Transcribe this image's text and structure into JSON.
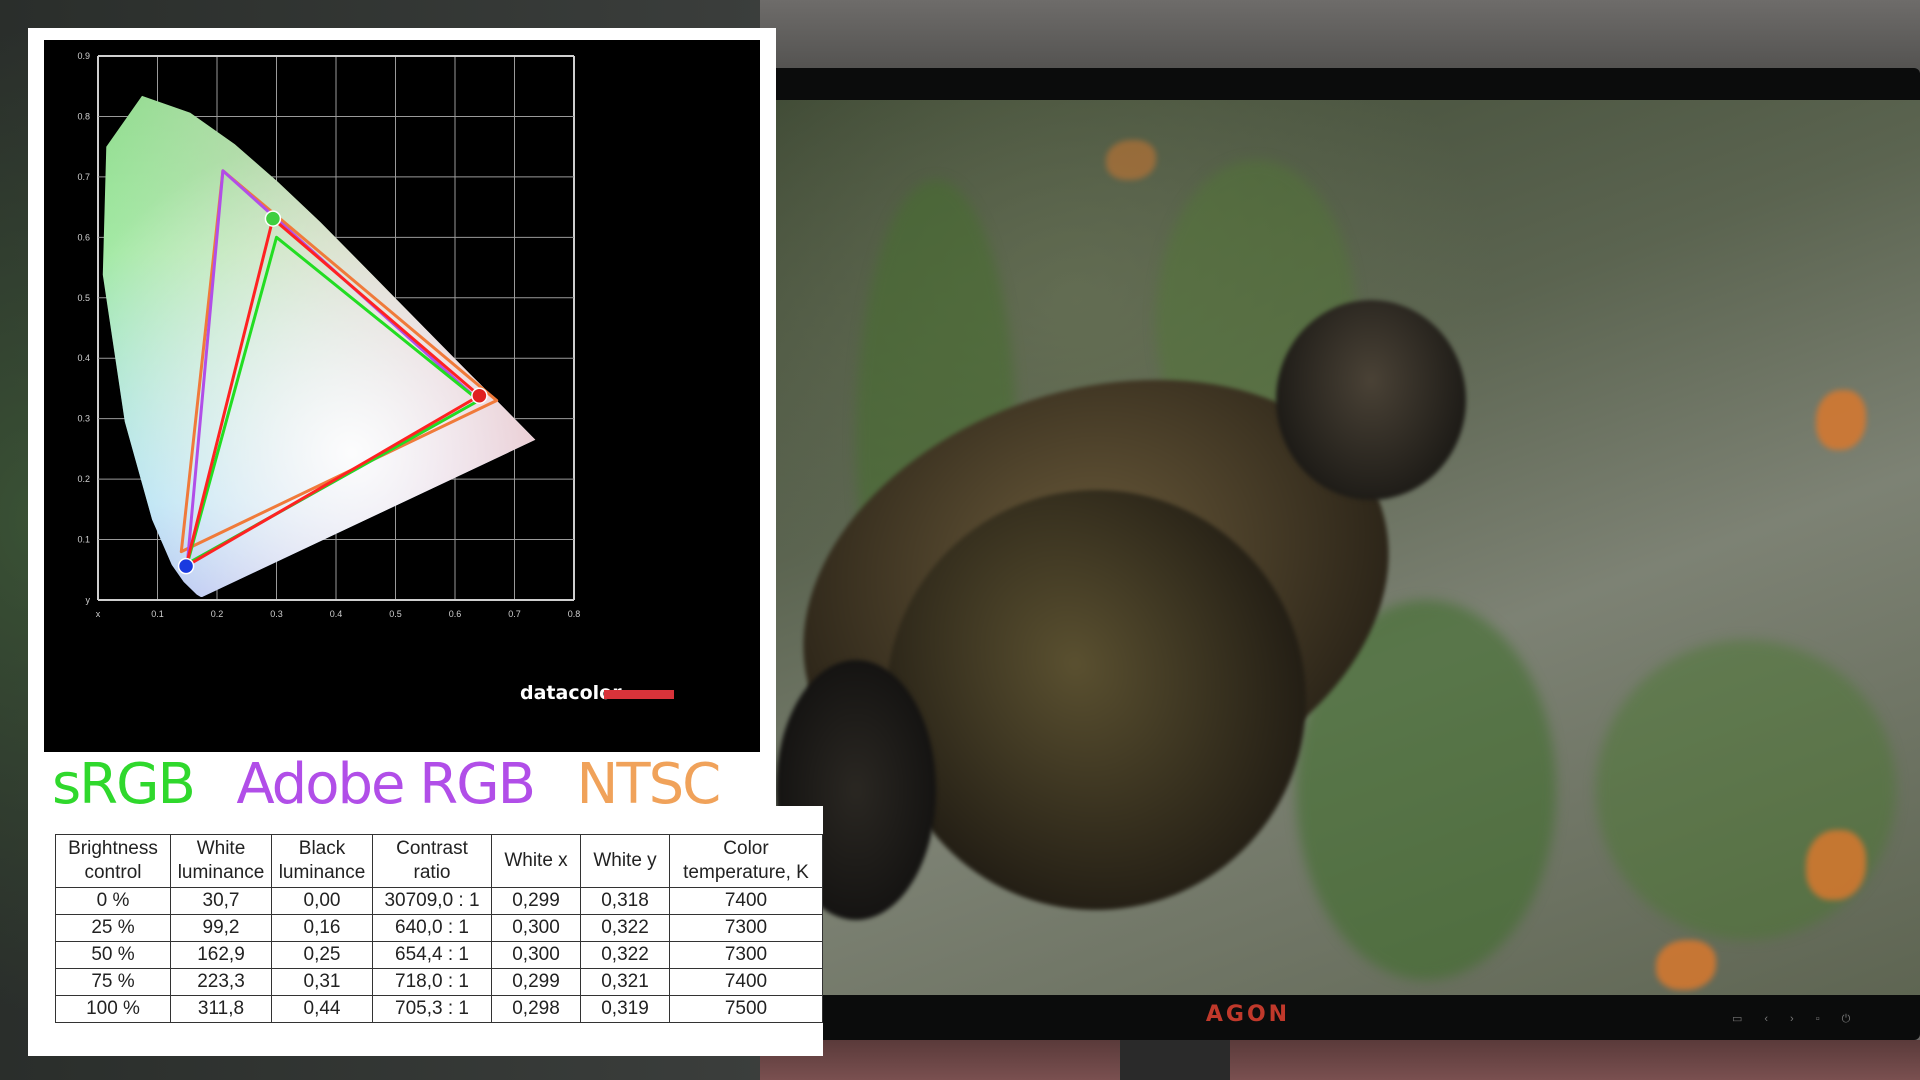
{
  "monitor": {
    "brand": "AGON"
  },
  "gamut_legend": [
    {
      "label": "sRGB",
      "color": "#2fd82c"
    },
    {
      "label": "Adobe RGB",
      "color": "#b14ee8"
    },
    {
      "label": "NTSC",
      "color": "#f0a25a"
    }
  ],
  "chart_data": {
    "type": "scatter",
    "brand_watermark": "datacolor",
    "xlim": [
      0,
      0.8
    ],
    "ylim": [
      0,
      0.9
    ],
    "x_ticks": [
      "x",
      "0.1",
      "0.2",
      "0.3",
      "0.4",
      "0.5",
      "0.6",
      "0.7",
      "0.8"
    ],
    "y_ticks": [
      "y",
      "0.1",
      "0.2",
      "0.3",
      "0.4",
      "0.5",
      "0.6",
      "0.7",
      "0.8",
      "0.9"
    ],
    "grid": true,
    "spectral_locus": [
      [
        0.175,
        0.005
      ],
      [
        0.173,
        0.005
      ],
      [
        0.166,
        0.009
      ],
      [
        0.144,
        0.03
      ],
      [
        0.124,
        0.058
      ],
      [
        0.091,
        0.133
      ],
      [
        0.045,
        0.295
      ],
      [
        0.008,
        0.538
      ],
      [
        0.014,
        0.75
      ],
      [
        0.074,
        0.834
      ],
      [
        0.155,
        0.806
      ],
      [
        0.23,
        0.754
      ],
      [
        0.302,
        0.692
      ],
      [
        0.374,
        0.625
      ],
      [
        0.444,
        0.555
      ],
      [
        0.512,
        0.487
      ],
      [
        0.575,
        0.424
      ],
      [
        0.627,
        0.372
      ],
      [
        0.666,
        0.334
      ],
      [
        0.735,
        0.265
      ]
    ],
    "series": [
      {
        "name": "sRGB",
        "color": "#22dd22",
        "points": [
          [
            0.64,
            0.33
          ],
          [
            0.3,
            0.6
          ],
          [
            0.15,
            0.06
          ]
        ]
      },
      {
        "name": "Adobe RGB",
        "color": "#b14ee8",
        "points": [
          [
            0.64,
            0.33
          ],
          [
            0.21,
            0.71
          ],
          [
            0.15,
            0.06
          ]
        ]
      },
      {
        "name": "NTSC",
        "color": "#f07a3a",
        "points": [
          [
            0.67,
            0.33
          ],
          [
            0.21,
            0.71
          ],
          [
            0.14,
            0.08
          ]
        ]
      },
      {
        "name": "Measured",
        "color": "#ff2222",
        "points": [
          [
            0.641,
            0.338
          ],
          [
            0.294,
            0.631
          ],
          [
            0.148,
            0.056
          ]
        ]
      }
    ],
    "primaries": [
      {
        "color": "#e02020",
        "x": 0.641,
        "y": 0.338
      },
      {
        "color": "#3fcf3f",
        "x": 0.294,
        "y": 0.631
      },
      {
        "color": "#1a3ae0",
        "x": 0.148,
        "y": 0.056
      }
    ]
  },
  "table": {
    "headers": [
      "Brightness control",
      "White luminance",
      "Black luminance",
      "Contrast ratio",
      "White x",
      "White y",
      "Color temperature, K"
    ],
    "header_lines": [
      [
        "Brightness",
        "control"
      ],
      [
        "White",
        "luminance"
      ],
      [
        "Black",
        "luminance"
      ],
      [
        "Contrast",
        "ratio"
      ],
      [
        "White x"
      ],
      [
        "White y"
      ],
      [
        "Color",
        "temperature, K"
      ]
    ],
    "rows": [
      [
        "0 %",
        "30,7",
        "0,00",
        "30709,0 : 1",
        "0,299",
        "0,318",
        "7400"
      ],
      [
        "25 %",
        "99,2",
        "0,16",
        "640,0 : 1",
        "0,300",
        "0,322",
        "7300"
      ],
      [
        "50 %",
        "162,9",
        "0,25",
        "654,4 : 1",
        "0,300",
        "0,322",
        "7300"
      ],
      [
        "75 %",
        "223,3",
        "0,31",
        "718,0 : 1",
        "0,299",
        "0,321",
        "7400"
      ],
      [
        "100 %",
        "311,8",
        "0,44",
        "705,3 : 1",
        "0,298",
        "0,319",
        "7500"
      ]
    ]
  }
}
